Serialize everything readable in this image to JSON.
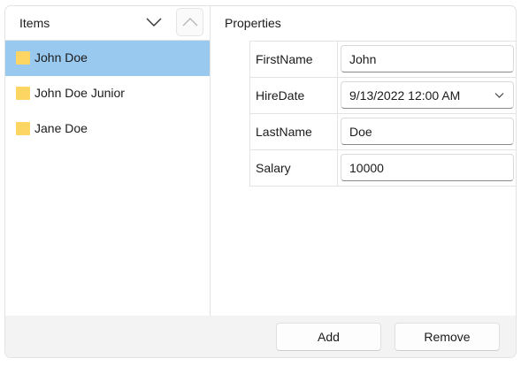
{
  "items_panel": {
    "title": "Items",
    "items": [
      {
        "label": "John Doe",
        "selected": true
      },
      {
        "label": "John Doe Junior",
        "selected": false
      },
      {
        "label": "Jane Doe",
        "selected": false
      }
    ]
  },
  "properties_panel": {
    "title": "Properties",
    "rows": [
      {
        "name": "FirstName",
        "value": "John"
      },
      {
        "name": "HireDate",
        "value": "9/13/2022 12:00 AM"
      },
      {
        "name": "LastName",
        "value": "Doe"
      },
      {
        "name": "Salary",
        "value": "10000"
      }
    ]
  },
  "footer": {
    "add_label": "Add",
    "remove_label": "Remove"
  },
  "colors": {
    "selection": "#99c9ef",
    "folder": "#fdd563",
    "footer_bg": "#f3f3f3"
  },
  "icons": {
    "collapse": "chevron-down-icon",
    "move_up": "chevron-up-icon",
    "item": "folder-icon",
    "dropdown": "chevron-down-icon"
  }
}
